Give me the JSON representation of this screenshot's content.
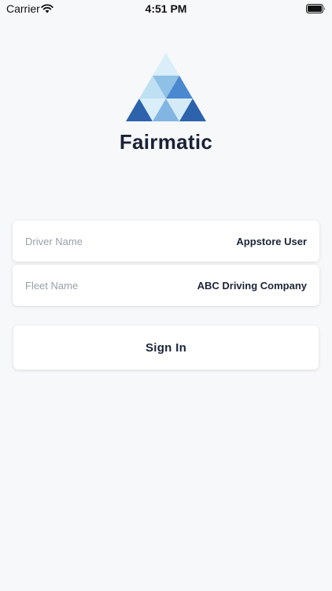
{
  "status_bar": {
    "carrier": "Carrier",
    "time": "4:51 PM"
  },
  "brand": {
    "name": "Fairmatic"
  },
  "form": {
    "driver_label": "Driver Name",
    "driver_value": "Appstore User",
    "fleet_label": "Fleet Name",
    "fleet_value": "ABC Driving Company"
  },
  "sign_in_label": "Sign In",
  "colors": {
    "background": "#f7f8fa",
    "text": "#1b2438",
    "label": "#9aa0a8",
    "brand_blue": "#2f65b1"
  }
}
